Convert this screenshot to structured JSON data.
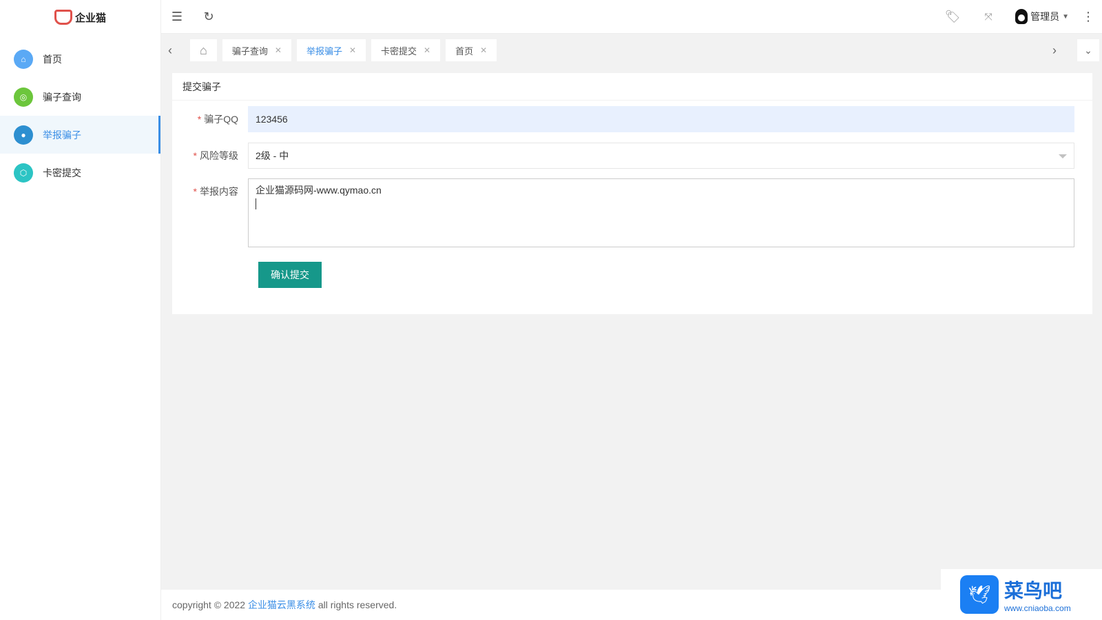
{
  "logo": {
    "text": "企业猫"
  },
  "sidebar": {
    "items": [
      {
        "label": "首页",
        "color": "#5aa9f5",
        "icon": "home-icon"
      },
      {
        "label": "骗子查询",
        "color": "#6cc63c",
        "icon": "shield-icon"
      },
      {
        "label": "举报骗子",
        "color": "#2d8fd0",
        "icon": "circle-icon",
        "active": true
      },
      {
        "label": "卡密提交",
        "color": "#2cc4c4",
        "icon": "hexagon-icon"
      }
    ]
  },
  "header": {
    "user": "管理员"
  },
  "tabs": [
    {
      "label": "骗子查询"
    },
    {
      "label": "举报骗子",
      "active": true
    },
    {
      "label": "卡密提交"
    },
    {
      "label": "首页"
    }
  ],
  "card": {
    "title": "提交骗子"
  },
  "form": {
    "qq_label": "骗子QQ",
    "qq_value": "123456",
    "level_label": "风险等级",
    "level_value": "2级 - 中",
    "content_label": "举报内容",
    "content_value": "企业猫源码网-www.qymao.cn\n",
    "submit": "确认提交"
  },
  "footer": {
    "prefix": "copyright © 2022 ",
    "link": "企业猫云黑系统",
    "suffix": " all rights reserved."
  },
  "watermark": {
    "name": "菜鸟吧",
    "url": "www.cniaoba.com"
  }
}
